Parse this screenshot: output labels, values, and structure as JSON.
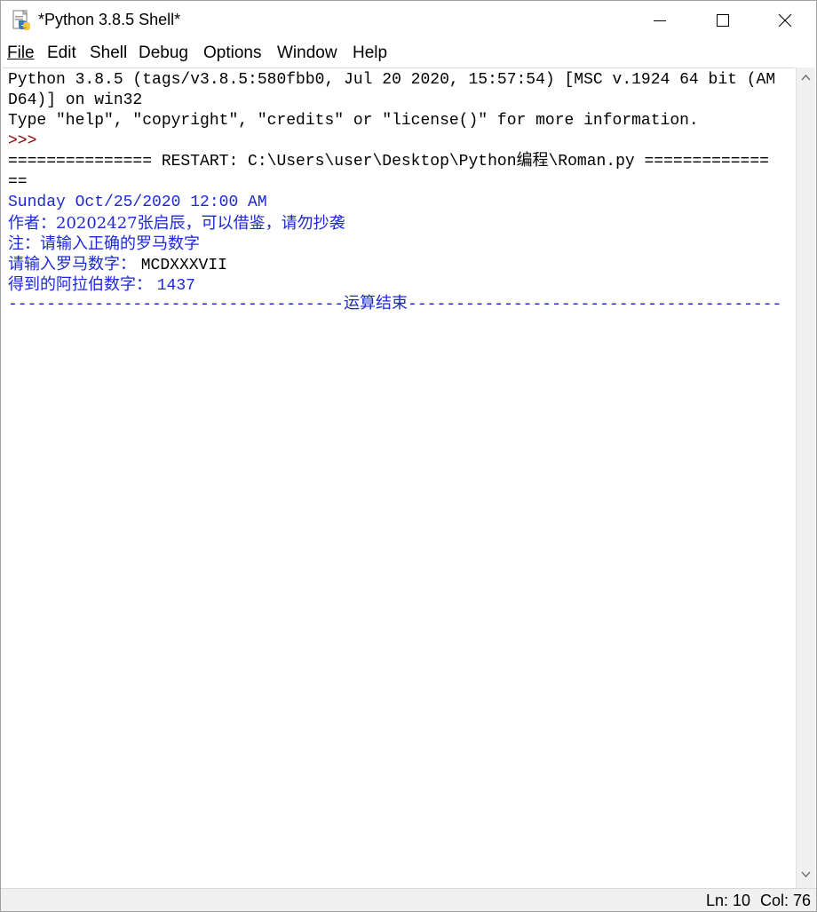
{
  "window": {
    "title": "*Python 3.8.5 Shell*",
    "icon": "python-idle-icon"
  },
  "menu": {
    "file": "File",
    "edit": "Edit",
    "shell": "Shell",
    "debug": "Debug",
    "options": "Options",
    "window": "Window",
    "help": "Help"
  },
  "shell": {
    "lines": [
      "Python 3.8.5 (tags/v3.8.5:580fbb0, Jul 20 2020, 15:57:54) [MSC v.1924 64 bit (AM",
      "D64)] on win32",
      "Type \"help\", \"copyright\", \"credits\" or \"license()\" for more information.",
      ">>> ",
      "=============== RESTART: C:\\Users\\user\\Desktop\\Python编程\\Roman.py =============",
      "==",
      "Sunday Oct/25/2020 12:00 AM",
      "作者：20202427张启辰，可以借鉴，请勿抄袭",
      "注：请输入正确的罗马数字",
      "请输入罗马数字： ",
      "MCDXXXVII",
      "得到的阿拉伯数字： ",
      "1437",
      "-----------------------------------运算结束---------------------------------------"
    ]
  },
  "status": {
    "ln": "Ln: 10",
    "col": "Col: 76"
  },
  "colors": {
    "stdout": "#1c28d6",
    "prompt": "#8b0000",
    "text": "#000000"
  }
}
